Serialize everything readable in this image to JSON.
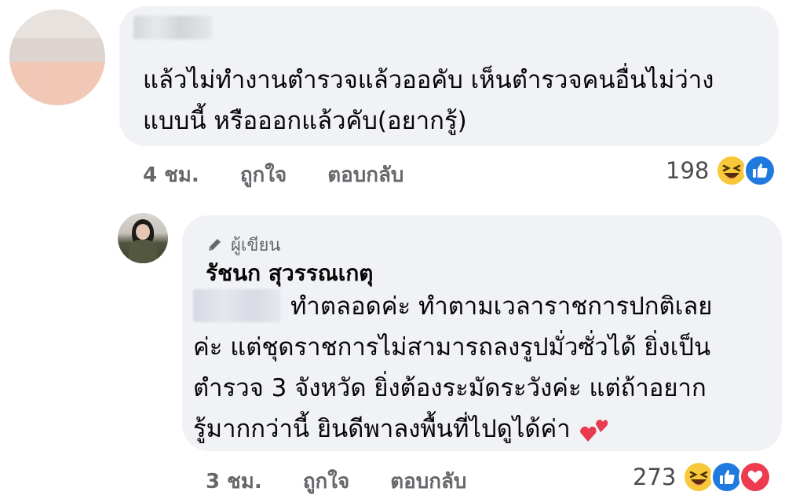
{
  "comment": {
    "lines": [
      "แล้วไม่ทำงานตำรวจแล้วออคับ เห็นตำรวจคนอื่นไม่ว่าง",
      "แบบนี้ หรือออกแล้วคับ(อยากรู้)"
    ],
    "time": "4 ชม.",
    "like_label": "ถูกใจ",
    "reply_label": "ตอบกลับ",
    "reaction_count": "198",
    "reactions": [
      "haha-icon",
      "like-icon"
    ]
  },
  "reply": {
    "author_badge": "ผู้เขียน",
    "author_name": "รัชนก สุวรรณเกตุ",
    "lines": [
      "ทำตลอดค่ะ ทำตามเวลาราชการปกติเลย",
      "ค่ะ แต่ชุดราชการไม่สามารถลงรูปมั่วซั่วได้ ยิ่งเป็น",
      "ตำรวจ 3 จังหวัด ยิ่งต้องระมัดระวังค่ะ แต่ถ้าอยาก",
      "รู้มากกว่านี้ ยินดีพาลงพื้นที่ไปดูได้ค่า"
    ],
    "time": "3 ชม.",
    "like_label": "ถูกใจ",
    "reply_label": "ตอบกลับ",
    "reaction_count": "273",
    "reactions": [
      "haha-icon",
      "like-icon",
      "love-icon"
    ]
  },
  "colors": {
    "bubble": "#f0f2f5",
    "meta_text": "#65676b",
    "like_blue": "#1f7ae0",
    "haha_yellow": "#f7c93a",
    "love_red": "#ef3b50"
  }
}
